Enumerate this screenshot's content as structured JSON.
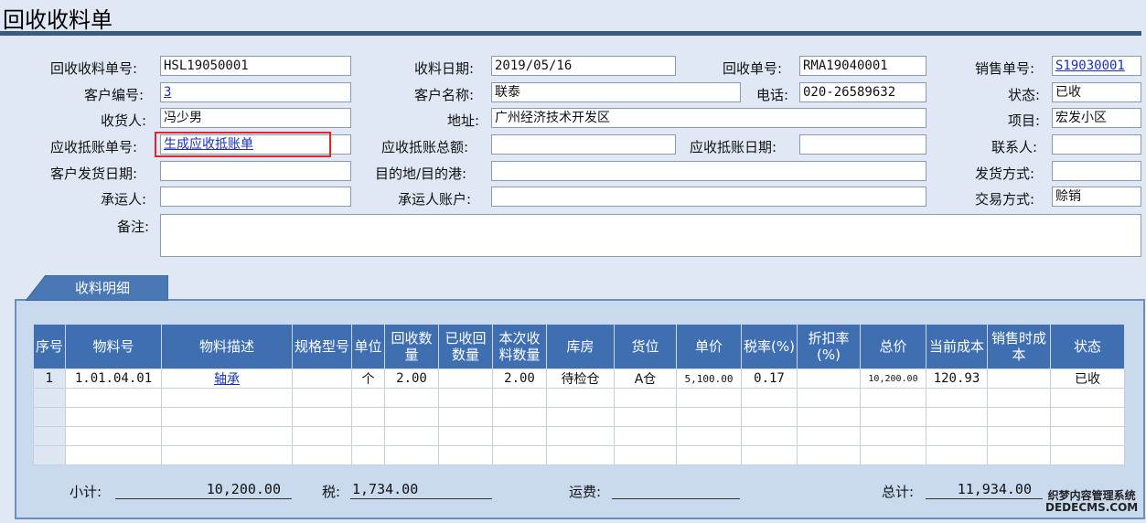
{
  "page": {
    "title": "回收收料单"
  },
  "form": {
    "recv_no_label": "回收收料单号:",
    "recv_no": "HSL19050001",
    "recv_date_label": "收料日期:",
    "recv_date": "2019/05/16",
    "rma_no_label": "回收单号:",
    "rma_no": "RMA19040001",
    "sales_no_label": "销售单号:",
    "sales_no": "S19030001",
    "cust_no_label": "客户编号:",
    "cust_no": "3",
    "cust_name_label": "客户名称:",
    "cust_name": "联泰",
    "phone_label": "电话:",
    "phone": "020-26589632",
    "status_label": "状态:",
    "status": "已收",
    "receiver_label": "收货人:",
    "receiver": "冯少男",
    "address_label": "地址:",
    "address": "广州经济技术开发区",
    "project_label": "项目:",
    "project": "宏发小区",
    "ar_no_label": "应收抵账单号:",
    "ar_link": "生成应收抵账单",
    "ar_total_label": "应收抵账总额:",
    "ar_total": "",
    "ar_date_label": "应收抵账日期:",
    "ar_date": "",
    "contact_label": "联系人:",
    "contact": "",
    "ship_date_label": "客户发货日期:",
    "ship_date": "",
    "dest_label": "目的地/目的港:",
    "dest": "",
    "ship_method_label": "发货方式:",
    "ship_method": "",
    "carrier_label": "承运人:",
    "carrier": "",
    "carrier_acct_label": "承运人账户:",
    "carrier_acct": "",
    "trade_label": "交易方式:",
    "trade": "赊销",
    "memo_label": "备注:",
    "memo": ""
  },
  "detail": {
    "tab_label": "收料明细",
    "headers": [
      "序号",
      "物料号",
      "物料描述",
      "规格型号",
      "单位",
      "回收数量",
      "已收回数量",
      "本次收料数量",
      "库房",
      "货位",
      "单价",
      "税率(%)",
      "折扣率(%)",
      "总价",
      "当前成本",
      "销售时成本",
      "状态"
    ],
    "rows": [
      [
        "1",
        "1.01.04.01",
        "轴承",
        "",
        "个",
        "2.00",
        "",
        "2.00",
        "待检仓",
        "A仓",
        "5,100.00",
        "0.17",
        "",
        "10,200.00",
        "120.93",
        "",
        "已收"
      ]
    ]
  },
  "summary": {
    "subtotal_label": "小计:",
    "subtotal": "10,200.00",
    "tax_label": "税:",
    "tax": "1,734.00",
    "freight_label": "运费:",
    "freight": "",
    "total_label": "总计:",
    "total": "11,934.00"
  },
  "watermark": {
    "line1": "织梦内容管理系统",
    "line2": "DEDECMS.COM"
  },
  "colors": {
    "header_bg": "#3f6fb0",
    "title_bar": "#3a5a85",
    "highlight": "#e0262b",
    "link": "#1a2fbf"
  }
}
